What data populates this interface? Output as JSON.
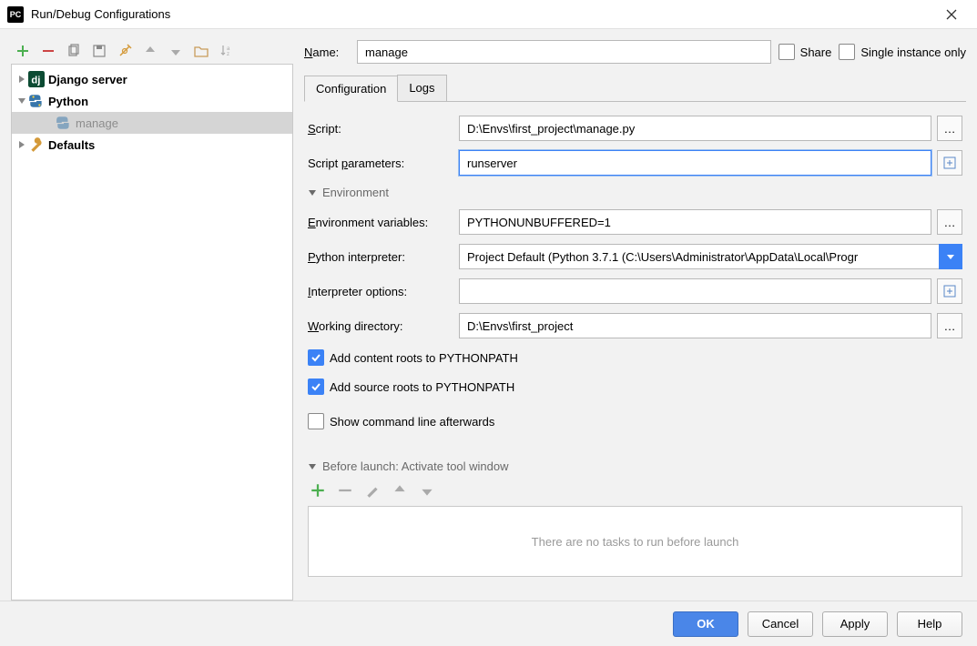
{
  "window": {
    "title": "Run/Debug Configurations",
    "icon_text": "PC"
  },
  "top": {
    "name_label": "Name:",
    "name_value": "manage",
    "share_label": "Share",
    "single_instance_label": "Single instance only"
  },
  "tree": {
    "items": [
      {
        "label": "Django server",
        "bold": true,
        "icon": "django"
      },
      {
        "label": "Python",
        "bold": true,
        "icon": "python"
      },
      {
        "label": "manage",
        "child": true,
        "selected": true,
        "icon": "python-faded"
      },
      {
        "label": "Defaults",
        "bold": true,
        "icon": "wrench"
      }
    ]
  },
  "tabs": {
    "configuration": "Configuration",
    "logs": "Logs"
  },
  "form": {
    "script_label": "Script:",
    "script_value": "D:\\Envs\\first_project\\manage.py",
    "params_label": "Script parameters:",
    "params_value": "runserver",
    "env_section": "Environment",
    "envvars_label": "Environment variables:",
    "envvars_value": "PYTHONUNBUFFERED=1",
    "interp_label": "Python interpreter:",
    "interp_value": "Project Default (Python 3.7.1 (C:\\Users\\Administrator\\AppData\\Local\\Progr",
    "interp_opts_label": "Interpreter options:",
    "interp_opts_value": "",
    "workdir_label": "Working directory:",
    "workdir_value": "D:\\Envs\\first_project",
    "add_content_roots": "Add content roots to PYTHONPATH",
    "add_source_roots": "Add source roots to PYTHONPATH",
    "show_cmdline": "Show command line afterwards"
  },
  "before_launch": {
    "header": "Before launch: Activate tool window",
    "empty_text": "There are no tasks to run before launch"
  },
  "buttons": {
    "ok": "OK",
    "cancel": "Cancel",
    "apply": "Apply",
    "help": "Help"
  }
}
